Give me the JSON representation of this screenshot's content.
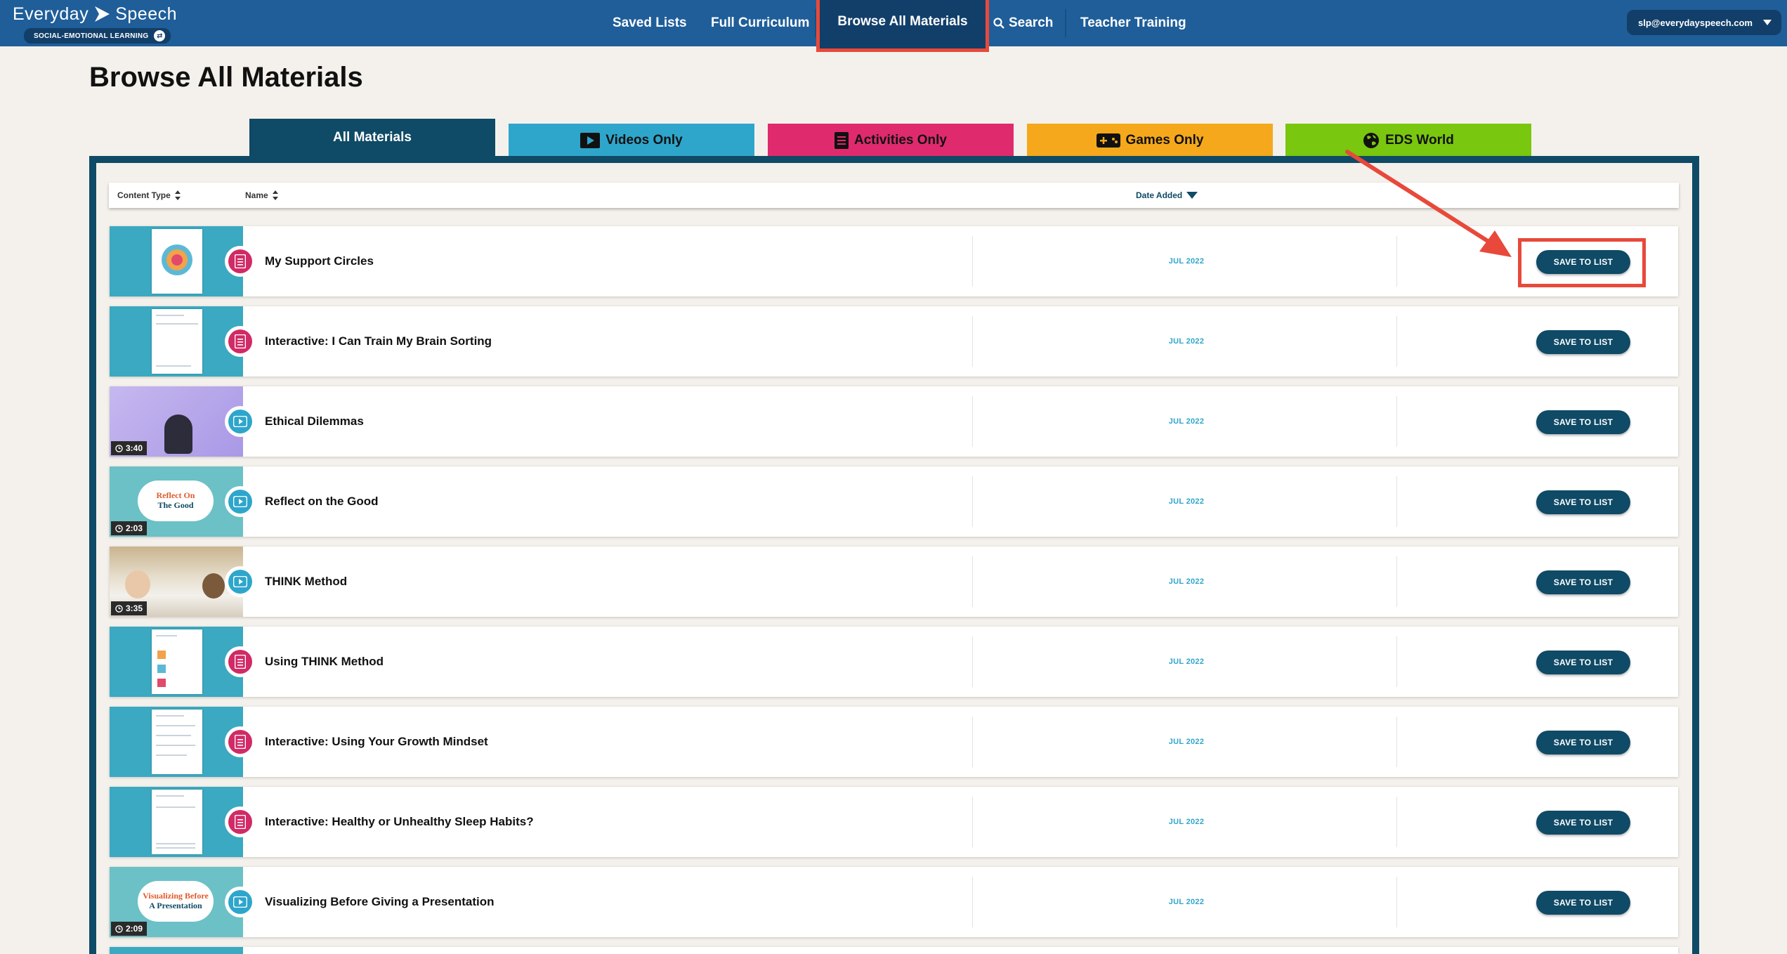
{
  "nav": {
    "logo_left": "Everyday",
    "logo_right": "Speech",
    "logo_badge": "SOCIAL-EMOTIONAL LEARNING",
    "links": {
      "saved": "Saved Lists",
      "curriculum": "Full Curriculum",
      "browse": "Browse All Materials",
      "search": "Search",
      "training": "Teacher Training"
    },
    "account": "slp@everydayspeech.com"
  },
  "page": {
    "title": "Browse All Materials"
  },
  "tabs": {
    "all": "All Materials",
    "videos": "Videos Only",
    "activities": "Activities Only",
    "games": "Games Only",
    "world": "EDS World"
  },
  "header": {
    "content_type": "Content Type",
    "name": "Name",
    "date_added": "Date Added"
  },
  "colors": {
    "nav_blue": "#1f5e99",
    "dark_teal": "#0f4a66",
    "video_blue": "#2ea6cc",
    "activity_pink": "#e02a6e",
    "games_orange": "#f6a81c",
    "world_green": "#79c70e",
    "annotation_red": "#e8493a"
  },
  "save_label": "SAVE TO LIST",
  "rows": [
    {
      "title": "My Support Circles",
      "type": "activity",
      "date": "JUL 2022",
      "duration": ""
    },
    {
      "title": "Interactive: I Can Train My Brain Sorting",
      "type": "activity",
      "date": "JUL 2022",
      "duration": ""
    },
    {
      "title": "Ethical Dilemmas",
      "type": "video",
      "date": "JUL 2022",
      "duration": "3:40"
    },
    {
      "title": "Reflect on the Good",
      "type": "video",
      "date": "JUL 2022",
      "duration": "2:03",
      "thumb_text": [
        "Reflect On",
        "The Good"
      ]
    },
    {
      "title": "THINK Method",
      "type": "video",
      "date": "JUL 2022",
      "duration": "3:35"
    },
    {
      "title": "Using THINK Method",
      "type": "activity",
      "date": "JUL 2022",
      "duration": ""
    },
    {
      "title": "Interactive: Using Your Growth Mindset",
      "type": "activity",
      "date": "JUL 2022",
      "duration": ""
    },
    {
      "title": "Interactive: Healthy or Unhealthy Sleep Habits?",
      "type": "activity",
      "date": "JUL 2022",
      "duration": ""
    },
    {
      "title": "Visualizing Before Giving a Presentation",
      "type": "video",
      "date": "JUL 2022",
      "duration": "2:09",
      "thumb_text": [
        "Visualizing Before",
        "A Presentation"
      ]
    }
  ]
}
